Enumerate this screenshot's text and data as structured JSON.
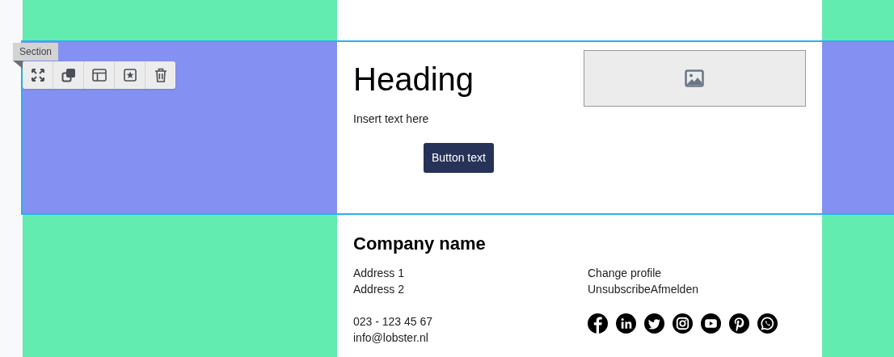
{
  "section_label": "Section",
  "hero": {
    "heading": "Heading",
    "text": "Insert text here",
    "button": "Button text"
  },
  "footer": {
    "company": "Company name",
    "address": [
      "Address 1",
      "Address 2"
    ],
    "links": [
      "Change profile",
      "UnsubscribeAfmelden"
    ],
    "contact": [
      "023 - 123 45 67",
      "info@lobster.nl"
    ]
  }
}
